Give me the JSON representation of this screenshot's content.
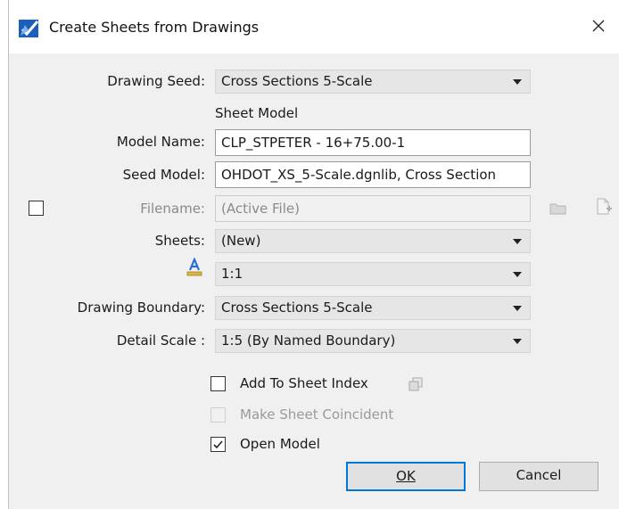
{
  "window": {
    "title": "Create Sheets from Drawings"
  },
  "form": {
    "drawing_seed": {
      "label": "Drawing Seed:",
      "value": "Cross Sections 5-Scale"
    },
    "section_heading": "Sheet Model",
    "model_name": {
      "label": "Model Name:",
      "value": "CLP_STPETER - 16+75.00-1"
    },
    "seed_model": {
      "label": "Seed Model:",
      "value": "OHDOT_XS_5-Scale.dgnlib, Cross Section"
    },
    "filename": {
      "label": "Filename:",
      "value": "(Active File)",
      "checked": false
    },
    "sheets": {
      "label": "Sheets:",
      "value": "(New)"
    },
    "annotation_scale": {
      "value": "1:1"
    },
    "drawing_boundary": {
      "label": "Drawing Boundary:",
      "value": "Cross Sections 5-Scale"
    },
    "detail_scale": {
      "label": "Detail Scale :",
      "value": "1:5 (By Named Boundary)"
    }
  },
  "options": {
    "add_to_sheet_index": {
      "label": "Add To Sheet Index",
      "checked": false
    },
    "make_sheet_coincident": {
      "label": "Make Sheet Coincident",
      "checked": false,
      "enabled": false
    },
    "open_model": {
      "label": "Open Model",
      "checked": true
    }
  },
  "buttons": {
    "ok": "OK",
    "cancel": "Cancel"
  },
  "colors": {
    "accent": "#0078d7",
    "annotation_icon": "#2b6fd6"
  }
}
